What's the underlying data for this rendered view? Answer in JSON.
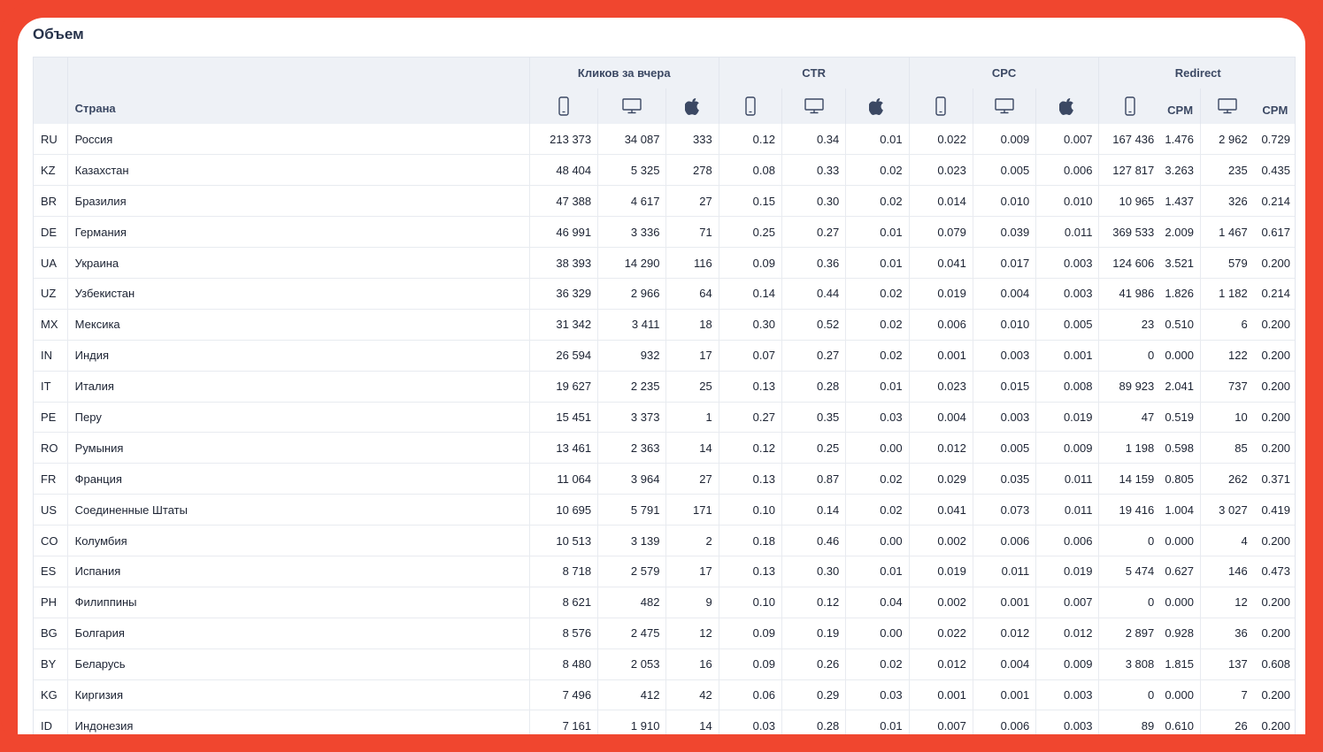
{
  "title": "Объем",
  "headers": {
    "country": "Страна",
    "groups": {
      "clicks": "Кликов за вчера",
      "ctr": "CTR",
      "cpc": "CPC",
      "redirect": "Redirect"
    },
    "cpm": "CPM"
  },
  "icons": {
    "mobile": "mobile-phone-icon",
    "desktop": "desktop-monitor-icon",
    "apple": "apple-icon"
  },
  "rows": [
    {
      "code": "RU",
      "name": "Россия",
      "c": [
        "213 373",
        "34 087",
        "333",
        "0.12",
        "0.34",
        "0.01",
        "0.022",
        "0.009",
        "0.007",
        "167 436",
        "1.476",
        "2 962",
        "0.729"
      ]
    },
    {
      "code": "KZ",
      "name": "Казахстан",
      "c": [
        "48 404",
        "5 325",
        "278",
        "0.08",
        "0.33",
        "0.02",
        "0.023",
        "0.005",
        "0.006",
        "127 817",
        "3.263",
        "235",
        "0.435"
      ]
    },
    {
      "code": "BR",
      "name": "Бразилия",
      "c": [
        "47 388",
        "4 617",
        "27",
        "0.15",
        "0.30",
        "0.02",
        "0.014",
        "0.010",
        "0.010",
        "10 965",
        "1.437",
        "326",
        "0.214"
      ]
    },
    {
      "code": "DE",
      "name": "Германия",
      "c": [
        "46 991",
        "3 336",
        "71",
        "0.25",
        "0.27",
        "0.01",
        "0.079",
        "0.039",
        "0.011",
        "369 533",
        "2.009",
        "1 467",
        "0.617"
      ]
    },
    {
      "code": "UA",
      "name": "Украина",
      "c": [
        "38 393",
        "14 290",
        "116",
        "0.09",
        "0.36",
        "0.01",
        "0.041",
        "0.017",
        "0.003",
        "124 606",
        "3.521",
        "579",
        "0.200"
      ]
    },
    {
      "code": "UZ",
      "name": "Узбекистан",
      "c": [
        "36 329",
        "2 966",
        "64",
        "0.14",
        "0.44",
        "0.02",
        "0.019",
        "0.004",
        "0.003",
        "41 986",
        "1.826",
        "1 182",
        "0.214"
      ]
    },
    {
      "code": "MX",
      "name": "Мексика",
      "c": [
        "31 342",
        "3 411",
        "18",
        "0.30",
        "0.52",
        "0.02",
        "0.006",
        "0.010",
        "0.005",
        "23",
        "0.510",
        "6",
        "0.200"
      ]
    },
    {
      "code": "IN",
      "name": "Индия",
      "c": [
        "26 594",
        "932",
        "17",
        "0.07",
        "0.27",
        "0.02",
        "0.001",
        "0.003",
        "0.001",
        "0",
        "0.000",
        "122",
        "0.200"
      ]
    },
    {
      "code": "IT",
      "name": "Италия",
      "c": [
        "19 627",
        "2 235",
        "25",
        "0.13",
        "0.28",
        "0.01",
        "0.023",
        "0.015",
        "0.008",
        "89 923",
        "2.041",
        "737",
        "0.200"
      ]
    },
    {
      "code": "PE",
      "name": "Перу",
      "c": [
        "15 451",
        "3 373",
        "1",
        "0.27",
        "0.35",
        "0.03",
        "0.004",
        "0.003",
        "0.019",
        "47",
        "0.519",
        "10",
        "0.200"
      ]
    },
    {
      "code": "RO",
      "name": "Румыния",
      "c": [
        "13 461",
        "2 363",
        "14",
        "0.12",
        "0.25",
        "0.00",
        "0.012",
        "0.005",
        "0.009",
        "1 198",
        "0.598",
        "85",
        "0.200"
      ]
    },
    {
      "code": "FR",
      "name": "Франция",
      "c": [
        "11 064",
        "3 964",
        "27",
        "0.13",
        "0.87",
        "0.02",
        "0.029",
        "0.035",
        "0.011",
        "14 159",
        "0.805",
        "262",
        "0.371"
      ]
    },
    {
      "code": "US",
      "name": "Соединенные Штаты",
      "c": [
        "10 695",
        "5 791",
        "171",
        "0.10",
        "0.14",
        "0.02",
        "0.041",
        "0.073",
        "0.011",
        "19 416",
        "1.004",
        "3 027",
        "0.419"
      ]
    },
    {
      "code": "CO",
      "name": "Колумбия",
      "c": [
        "10 513",
        "3 139",
        "2",
        "0.18",
        "0.46",
        "0.00",
        "0.002",
        "0.006",
        "0.006",
        "0",
        "0.000",
        "4",
        "0.200"
      ]
    },
    {
      "code": "ES",
      "name": "Испания",
      "c": [
        "8 718",
        "2 579",
        "17",
        "0.13",
        "0.30",
        "0.01",
        "0.019",
        "0.011",
        "0.019",
        "5 474",
        "0.627",
        "146",
        "0.473"
      ]
    },
    {
      "code": "PH",
      "name": "Филиппины",
      "c": [
        "8 621",
        "482",
        "9",
        "0.10",
        "0.12",
        "0.04",
        "0.002",
        "0.001",
        "0.007",
        "0",
        "0.000",
        "12",
        "0.200"
      ]
    },
    {
      "code": "BG",
      "name": "Болгария",
      "c": [
        "8 576",
        "2 475",
        "12",
        "0.09",
        "0.19",
        "0.00",
        "0.022",
        "0.012",
        "0.012",
        "2 897",
        "0.928",
        "36",
        "0.200"
      ]
    },
    {
      "code": "BY",
      "name": "Беларусь",
      "c": [
        "8 480",
        "2 053",
        "16",
        "0.09",
        "0.26",
        "0.02",
        "0.012",
        "0.004",
        "0.009",
        "3 808",
        "1.815",
        "137",
        "0.608"
      ]
    },
    {
      "code": "KG",
      "name": "Киргизия",
      "c": [
        "7 496",
        "412",
        "42",
        "0.06",
        "0.29",
        "0.03",
        "0.001",
        "0.001",
        "0.003",
        "0",
        "0.000",
        "7",
        "0.200"
      ]
    },
    {
      "code": "ID",
      "name": "Индонезия",
      "c": [
        "7 161",
        "1 910",
        "14",
        "0.03",
        "0.28",
        "0.01",
        "0.007",
        "0.006",
        "0.003",
        "89",
        "0.610",
        "26",
        "0.200"
      ]
    }
  ]
}
